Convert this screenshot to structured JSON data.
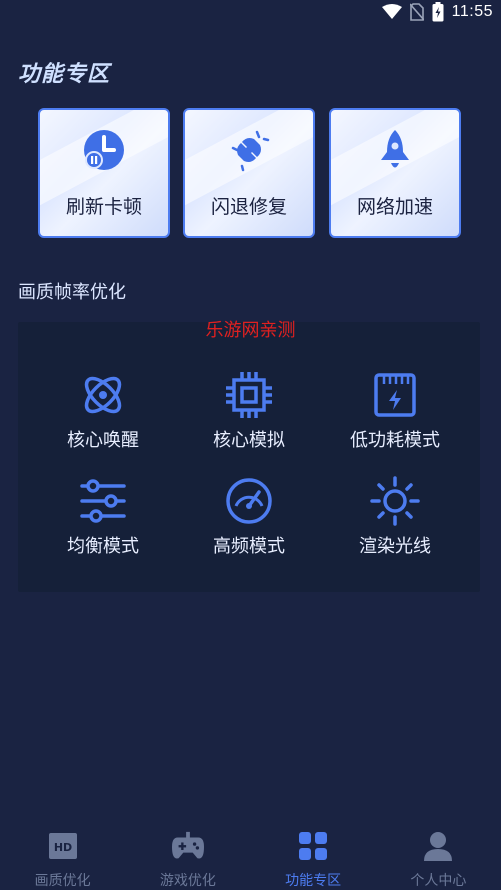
{
  "status_bar": {
    "time": "11:55",
    "icons": [
      "wifi-icon",
      "no-sim-icon",
      "battery-icon"
    ]
  },
  "header": {
    "title": "功能专区"
  },
  "quick_cards": [
    {
      "label": "刷新卡顿",
      "icon": "clock-icon"
    },
    {
      "label": "闪退修复",
      "icon": "plug-icon"
    },
    {
      "label": "网络加速",
      "icon": "rocket-icon"
    }
  ],
  "section": {
    "title": "画质帧率优化",
    "watermark": "乐游网亲测",
    "modes": [
      {
        "label": "核心唤醒",
        "icon": "atom-icon"
      },
      {
        "label": "核心模拟",
        "icon": "cpu-chip-icon"
      },
      {
        "label": "低功耗模式",
        "icon": "battery-bolt-icon"
      },
      {
        "label": "均衡模式",
        "icon": "sliders-icon"
      },
      {
        "label": "高频模式",
        "icon": "speedometer-icon"
      },
      {
        "label": "渲染光线",
        "icon": "sun-icon"
      }
    ]
  },
  "tab_bar": {
    "tabs": [
      {
        "label": "画质优化",
        "icon": "hd-icon",
        "active": false
      },
      {
        "label": "游戏优化",
        "icon": "gamepad-icon",
        "active": false
      },
      {
        "label": "功能专区",
        "icon": "grid-icon",
        "active": true
      },
      {
        "label": "个人中心",
        "icon": "person-icon",
        "active": false
      }
    ]
  },
  "colors": {
    "background": "#1a2342",
    "panel": "#152039",
    "accent": "#4d7cf0",
    "watermark": "#e02020",
    "inactive_tab": "#6b7898"
  }
}
